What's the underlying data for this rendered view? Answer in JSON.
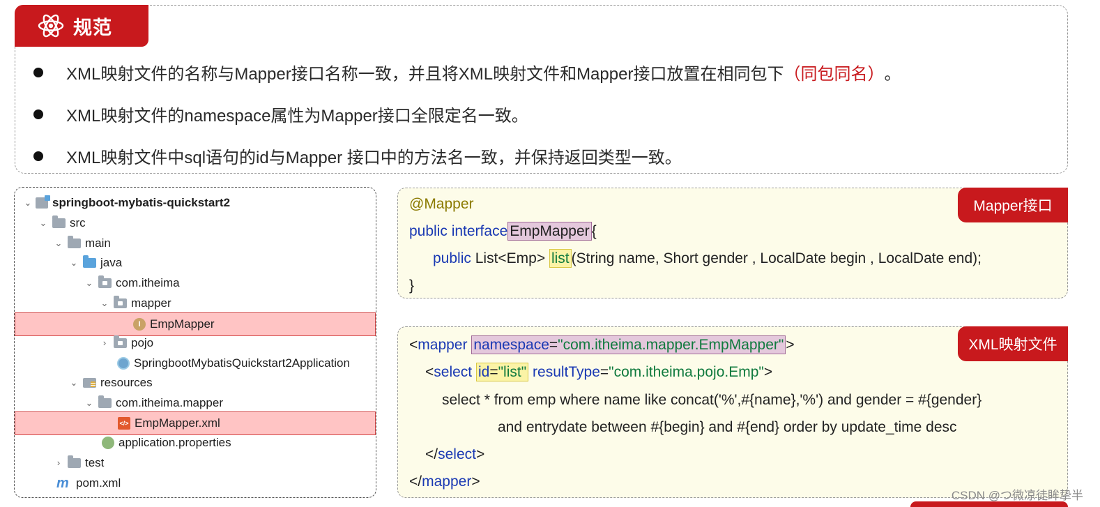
{
  "rules": {
    "title": "规范",
    "items": [
      {
        "text": "XML映射文件的名称与Mapper接口名称一致，并且将XML映射文件和Mapper接口放置在相同包下",
        "highlight": "（同包同名）",
        "tail": "。"
      },
      {
        "text": "XML映射文件的namespace属性为Mapper接口全限定名一致。",
        "highlight": "",
        "tail": ""
      },
      {
        "text": "XML映射文件中sql语句的id与Mapper 接口中的方法名一致，并保持返回类型一致。",
        "highlight": "",
        "tail": ""
      }
    ]
  },
  "tree": {
    "items": [
      {
        "label": "springboot-mybatis-quickstart2",
        "icon": "module-icon",
        "chevron": "v",
        "bold": true,
        "selected": false
      },
      {
        "label": "src",
        "icon": "folder-icon",
        "chevron": "v",
        "bold": false,
        "selected": false
      },
      {
        "label": "main",
        "icon": "folder-icon",
        "chevron": "v",
        "bold": false,
        "selected": false
      },
      {
        "label": "java",
        "icon": "source-folder-icon",
        "chevron": "v",
        "bold": false,
        "selected": false
      },
      {
        "label": "com.itheima",
        "icon": "package-icon",
        "chevron": "v",
        "bold": false,
        "selected": false
      },
      {
        "label": "mapper",
        "icon": "package-icon",
        "chevron": "v",
        "bold": false,
        "selected": false
      },
      {
        "label": "EmpMapper",
        "icon": "interface-icon",
        "chevron": "",
        "bold": false,
        "selected": true
      },
      {
        "label": "pojo",
        "icon": "package-icon",
        "chevron": ">",
        "bold": false,
        "selected": false
      },
      {
        "label": "SpringbootMybatisQuickstart2Application",
        "icon": "spring-app-icon",
        "chevron": "",
        "bold": false,
        "selected": false
      },
      {
        "label": "resources",
        "icon": "resources-folder-icon",
        "chevron": "v",
        "bold": false,
        "selected": false
      },
      {
        "label": "com.itheima.mapper",
        "icon": "folder-icon",
        "chevron": "v",
        "bold": false,
        "selected": false
      },
      {
        "label": "EmpMapper.xml",
        "icon": "xml-file-icon",
        "chevron": "",
        "bold": false,
        "selected": true
      },
      {
        "label": "application.properties",
        "icon": "properties-icon",
        "chevron": "",
        "bold": false,
        "selected": false
      },
      {
        "label": "test",
        "icon": "folder-icon",
        "chevron": ">",
        "bold": false,
        "selected": false
      },
      {
        "label": "pom.xml",
        "icon": "maven-icon",
        "chevron": "",
        "bold": false,
        "selected": false
      }
    ]
  },
  "mapper_code": {
    "tag": "Mapper接口",
    "annotation": "@Mapper",
    "decl_kw": "public interface",
    "interface_name": "EmpMapper",
    "brace_open": "{",
    "method_kw": "public",
    "method_ret": "List<Emp>",
    "method_name": "list",
    "method_params": "(String name, Short gender , LocalDate begin , LocalDate end);",
    "brace_close": "}"
  },
  "xml_code": {
    "tag": "XML映射文件",
    "mapper_open_lt": "<",
    "mapper_tag": "mapper",
    "ns_attr": "namespace",
    "ns_eq": "=",
    "ns_value": "\"com.itheima.mapper.EmpMapper\"",
    "gt": ">",
    "select_lt": "<",
    "select_tag": "select",
    "id_attr": "id",
    "id_eq": "=",
    "id_value": "\"list\"",
    "rt_attr": "resultType",
    "rt_eq": "=",
    "rt_value": "\"com.itheima.pojo.Emp\"",
    "select_gt": ">",
    "sql_line1": "select * from emp where name like concat('%',#{name},'%') and gender = #{gender}",
    "sql_line2": "and entrydate between #{begin} and #{end} order by update_time desc",
    "select_close_lt": "</",
    "select_close_tag": "select",
    "select_close_gt": ">",
    "mapper_close_lt": "</",
    "mapper_close_tag": "mapper",
    "mapper_close_gt": ">"
  },
  "watermark": "CSDN @つ微凉徒眸挚半",
  "colors": {
    "accent_red": "#c8191d",
    "code_bg": "#fdfce9",
    "selection": "#ffc4c4",
    "keyword": "#1a39b3",
    "string": "#107a3e",
    "annotation": "#8b7a00"
  }
}
